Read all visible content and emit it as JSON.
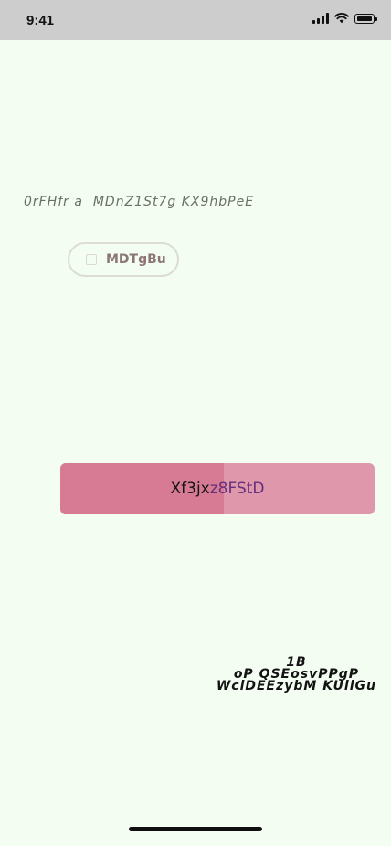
{
  "status_bar": {
    "time": "9:41",
    "icons": [
      "signal-icon",
      "wifi-icon",
      "battery-icon"
    ]
  },
  "content": {
    "italic_line": "0rFHfr a  MDnZ1St7g KX9hbPeE",
    "chip_button": {
      "label": "MDTgBu",
      "icon": "square-icon"
    },
    "progress": {
      "text_primary": "Xf3jx",
      "text_secondary": "z8FStD",
      "fraction": 0.52
    },
    "stacked_text": {
      "line1": "1B",
      "line2": "oP QSEosvPPgP",
      "line3": "WclDEEzybM KUilGu"
    }
  },
  "colors": {
    "background": "#f3fdf1",
    "status_bar": "#cdcdcd",
    "progress_fill": "#d77b94",
    "progress_track": "#df97ac"
  }
}
